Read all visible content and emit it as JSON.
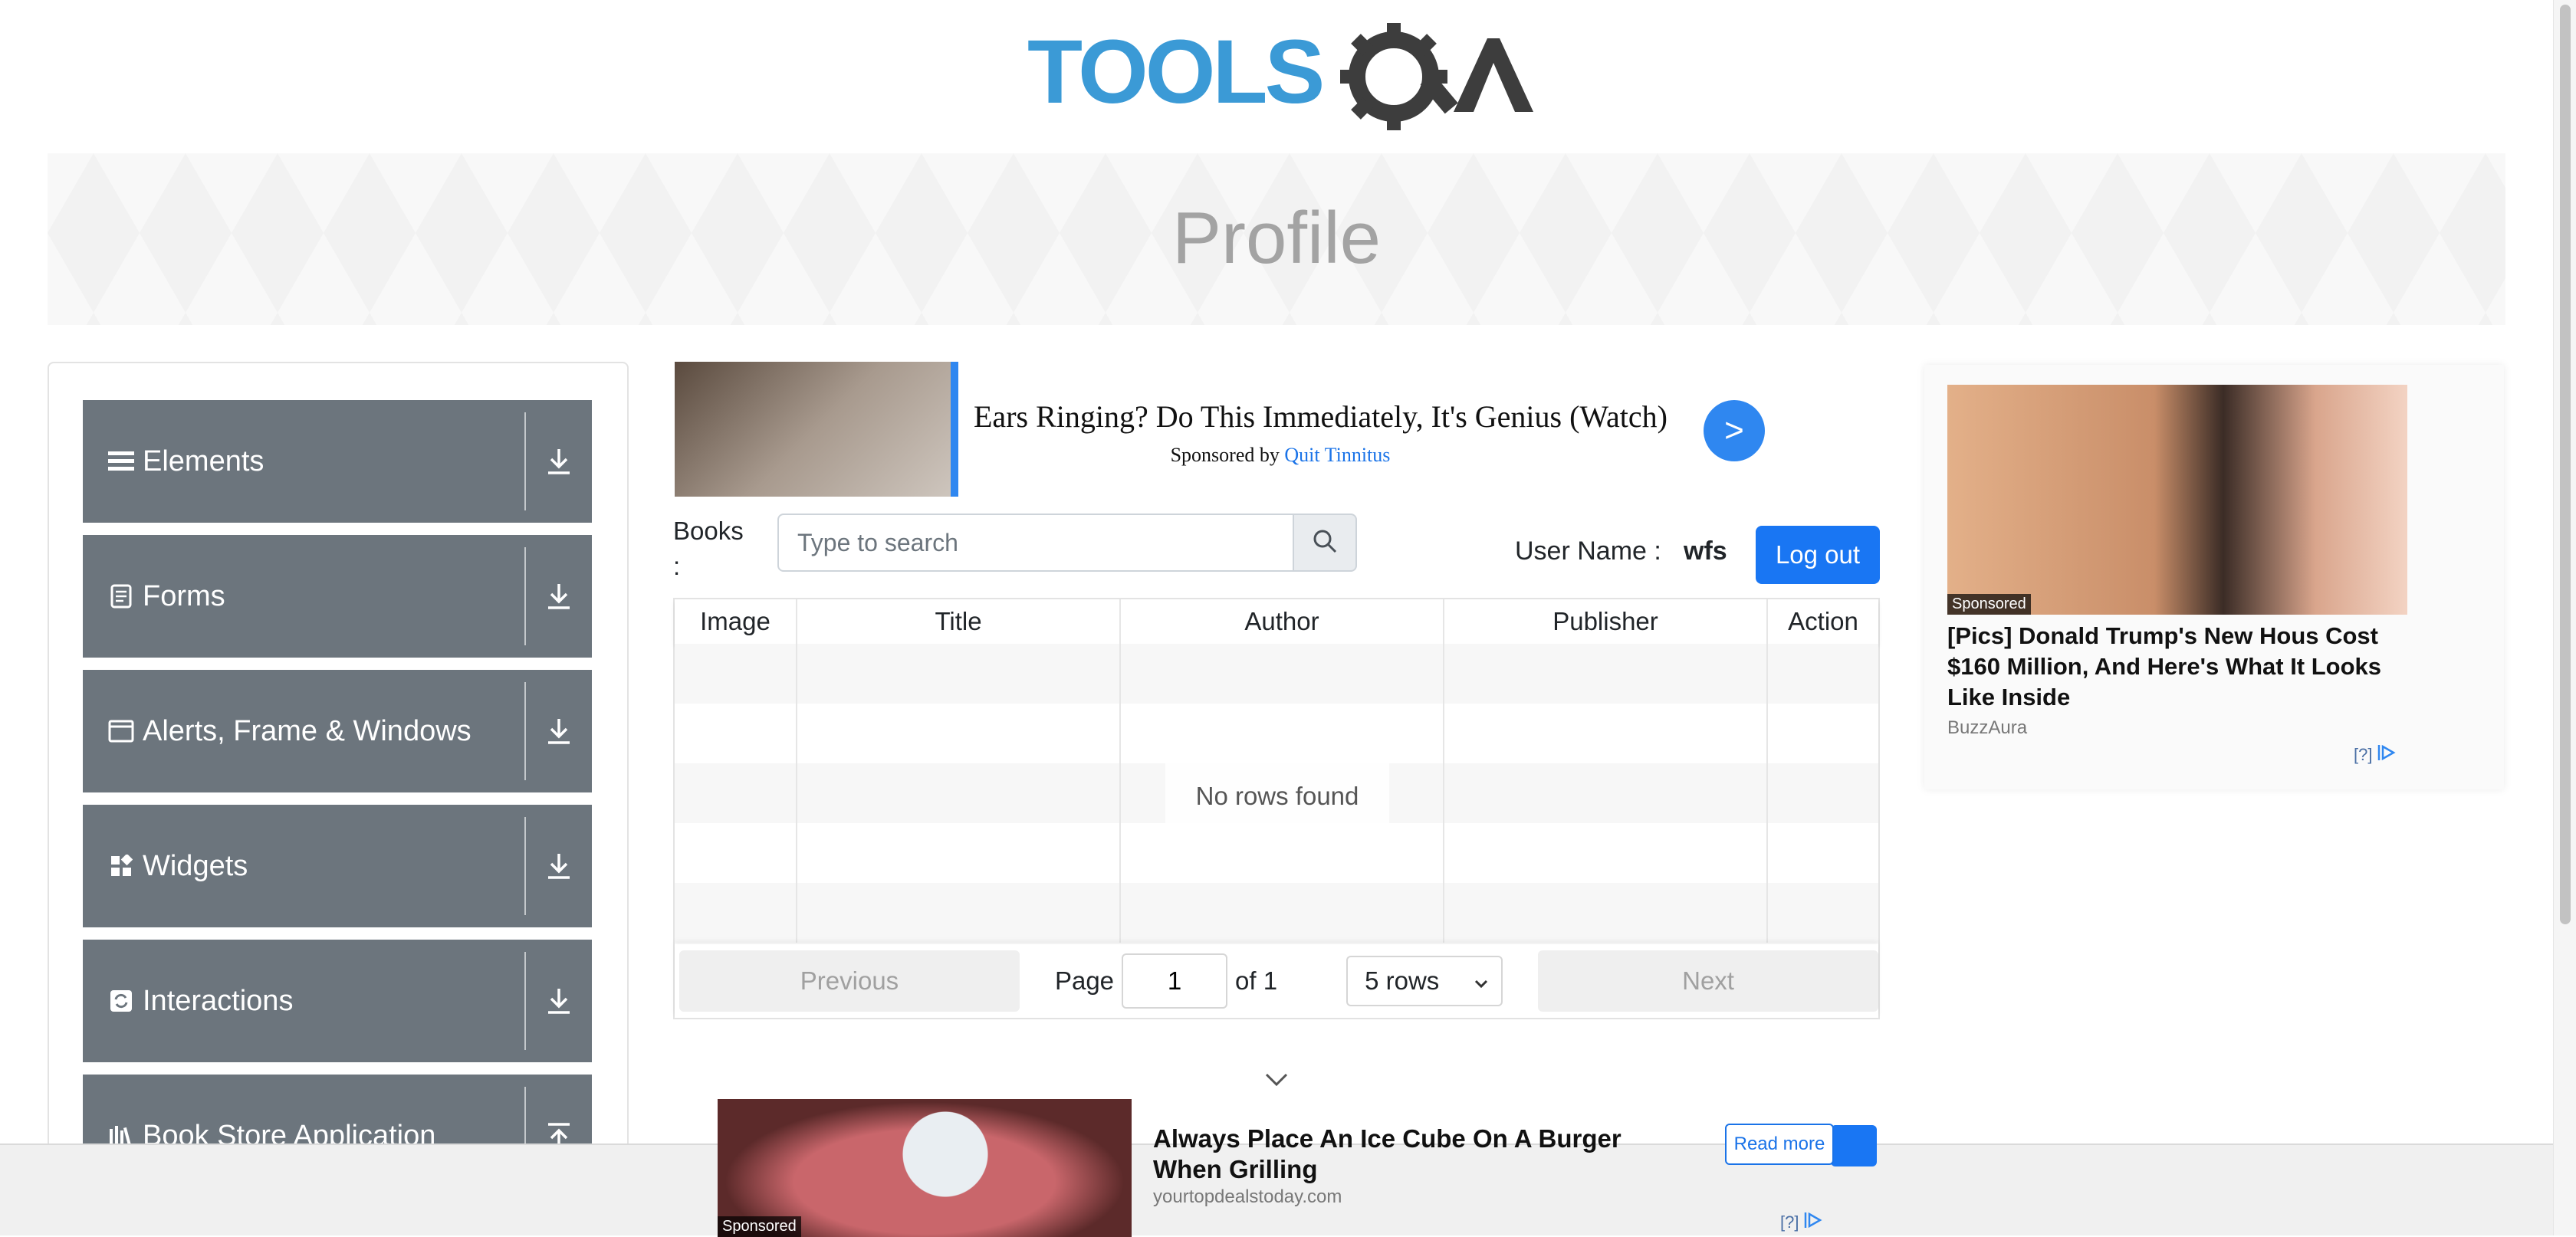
{
  "header": {
    "logo_alt": "TOOLSQA"
  },
  "banner": {
    "title": "Profile"
  },
  "sidebar": {
    "groups": [
      {
        "label": "Elements",
        "icon": "list-icon",
        "arrow": "download-arrow-icon"
      },
      {
        "label": "Forms",
        "icon": "form-icon",
        "arrow": "download-arrow-icon"
      },
      {
        "label": "Alerts, Frame & Windows",
        "icon": "window-icon",
        "arrow": "download-arrow-icon"
      },
      {
        "label": "Widgets",
        "icon": "widgets-icon",
        "arrow": "download-arrow-icon"
      },
      {
        "label": "Interactions",
        "icon": "interactions-icon",
        "arrow": "download-arrow-icon"
      },
      {
        "label": "Book Store Application",
        "icon": "bookstore-icon",
        "arrow": "upload-arrow-icon"
      }
    ]
  },
  "ad_top": {
    "headline": "Ears Ringing? Do This Immediately, It's Genius (Watch)",
    "sponsor_prefix": "Sponsored by",
    "sponsor_name": "Quit Tinnitus",
    "go_label": ">"
  },
  "books": {
    "label": "Books :",
    "search_placeholder": "Type to search",
    "search_value": ""
  },
  "user": {
    "label": "User Name :",
    "value": "wfs",
    "logout_label": "Log out"
  },
  "table": {
    "columns": [
      "Image",
      "Title",
      "Author",
      "Publisher",
      "Action"
    ],
    "empty_message": "No rows found"
  },
  "pagination": {
    "previous_label": "Previous",
    "page_label": "Page",
    "page_value": "1",
    "of_label": "of 1",
    "rows_option": "5 rows",
    "next_label": "Next"
  },
  "ad_right": {
    "sponsored_label": "Sponsored",
    "title": "[Pics] Donald Trump's New Hous Cost $160 Million, And Here's What It Looks Like Inside",
    "source": "BuzzAura",
    "adchoices_label": "[?]"
  },
  "ad_bottom": {
    "sponsored_label": "Sponsored",
    "title": "Always Place An Ice Cube On A Burger When Grilling",
    "source": "yourtopdealstoday.com",
    "read_more_label": "Read more",
    "adchoices_label": "[?]"
  },
  "colors": {
    "accent": "#1976f3",
    "sidebar_group": "#6c757d",
    "logo_blue": "#3b9ad6",
    "logo_dark": "#3d3d3d"
  }
}
